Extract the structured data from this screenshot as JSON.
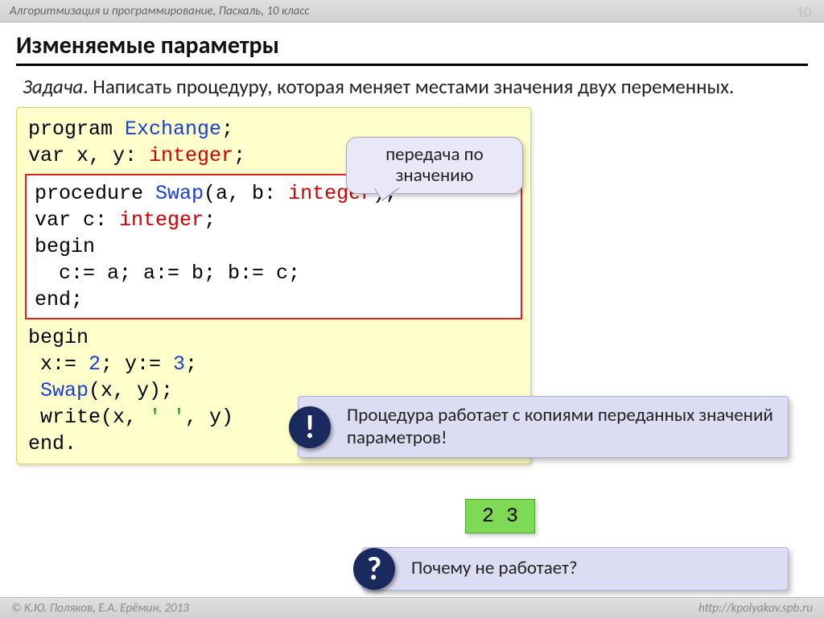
{
  "header": {
    "course": "Алгоритмизация и программирование, Паскаль, 10 класс",
    "page": "10"
  },
  "title": "Изменяемые параметры",
  "task": {
    "label": "Задача",
    "text": ". Написать процедуру, которая меняет местами значения двух переменных."
  },
  "code": {
    "l1a": "program ",
    "l1b": "Exchange",
    "l1c": ";",
    "l2a": "var x, y: ",
    "l2b": "integer",
    "l2c": ";",
    "p1a": "procedure ",
    "p1b": "Swap",
    "p1c": "(a, b: ",
    "p1d": "integer",
    "p1e": ");",
    "p2a": "var c: ",
    "p2b": "integer",
    "p2c": ";",
    "p3": "begin",
    "p4": "  c:= a; a:= b; b:= c;",
    "p5": "end;",
    "m1": "begin",
    "m2a": " x:= ",
    "m2b": "2",
    "m2c": "; y:= ",
    "m2d": "3",
    "m2e": ";",
    "m3a": " ",
    "m3b": "Swap",
    "m3c": "(x, y);",
    "m4a": " write(x, ",
    "m4b": "' '",
    "m4c": ", y)",
    "m5": "end."
  },
  "bubble": "передача по значению",
  "note1": "Процедура работает с копиями переданных значений параметров!",
  "note2": "Почему не работает?",
  "badge1": "!",
  "badge2": "?",
  "output": "2 3",
  "footer": {
    "left": "© К.Ю. Поляков, Е.А. Ерёмин, 2013",
    "right": "http://kpolyakov.spb.ru"
  }
}
